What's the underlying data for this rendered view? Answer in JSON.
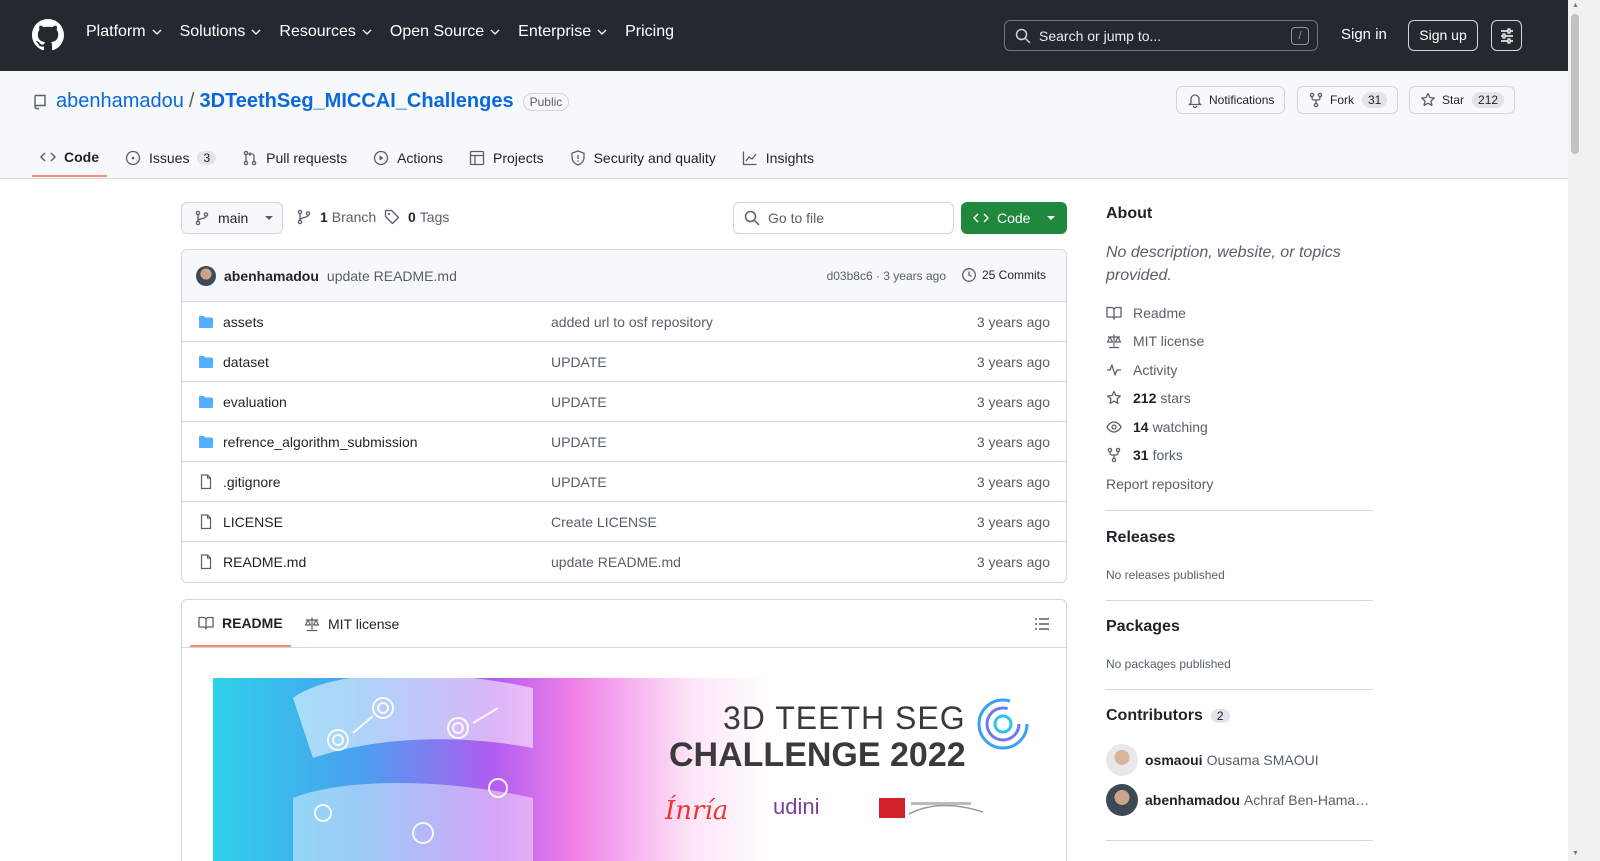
{
  "header": {
    "nav": [
      {
        "label": "Platform"
      },
      {
        "label": "Solutions"
      },
      {
        "label": "Resources"
      },
      {
        "label": "Open Source"
      },
      {
        "label": "Enterprise"
      },
      {
        "label": "Pricing"
      }
    ],
    "search_placeholder": "Search or jump to...",
    "search_shortcut": "/",
    "signin_label": "Sign in",
    "signup_label": "Sign up"
  },
  "repo": {
    "owner": "abenhamadou",
    "separator": "/",
    "name": "3DTeethSeg_MICCAI_Challenges",
    "visibility": "Public",
    "notifications_label": "Notifications",
    "fork_label": "Fork",
    "fork_count": "31",
    "star_label": "Star",
    "star_count": "212"
  },
  "tabs": [
    {
      "label": "Code"
    },
    {
      "label": "Issues",
      "count": "3"
    },
    {
      "label": "Pull requests"
    },
    {
      "label": "Actions"
    },
    {
      "label": "Projects"
    },
    {
      "label": "Security and quality"
    },
    {
      "label": "Insights"
    }
  ],
  "toolbar": {
    "branch": "main",
    "branch_count": "1",
    "branch_word": "Branch",
    "tag_count": "0",
    "tag_word": "Tags",
    "goto_placeholder": "Go to file",
    "code_label": "Code"
  },
  "commit": {
    "author": "abenhamadou",
    "message": "update README.md",
    "meta": "d03b8c6 · 3 years ago",
    "commits_label": "25 Commits"
  },
  "files": [
    {
      "type": "folder",
      "name": "assets",
      "message": "added url to osf repository",
      "age": "3 years ago"
    },
    {
      "type": "folder",
      "name": "dataset",
      "message": "UPDATE",
      "age": "3 years ago"
    },
    {
      "type": "folder",
      "name": "evaluation",
      "message": "UPDATE",
      "age": "3 years ago"
    },
    {
      "type": "folder",
      "name": "refrence_algorithm_submission",
      "message": "UPDATE",
      "age": "3 years ago"
    },
    {
      "type": "file",
      "name": ".gitignore",
      "message": "UPDATE",
      "age": "3 years ago"
    },
    {
      "type": "file",
      "name": "LICENSE",
      "message": "Create LICENSE",
      "age": "3 years ago"
    },
    {
      "type": "file",
      "name": "README.md",
      "message": "update README.md",
      "age": "3 years ago"
    }
  ],
  "readme": {
    "tab_readme": "README",
    "tab_license": "MIT license",
    "banner_line1": "3D TEETH SEG",
    "banner_line2": "CHALLENGE 2022",
    "banner_logo_inria": "Ínría",
    "banner_logo_udini": "udini"
  },
  "sidebar": {
    "about_title": "About",
    "about_desc": "No description, website, or topics provided.",
    "readme_link": "Readme",
    "license_link": "MIT license",
    "activity_link": "Activity",
    "stars_count": "212",
    "stars_word": "stars",
    "watching_count": "14",
    "watching_word": "watching",
    "forks_count": "31",
    "forks_word": "forks",
    "report_link": "Report repository",
    "releases_title": "Releases",
    "releases_text": "No releases published",
    "packages_title": "Packages",
    "packages_text": "No packages published",
    "contributors_title": "Contributors",
    "contributors_count": "2",
    "contributors": [
      {
        "login": "osmaoui",
        "name": "Ousama SMAOUI"
      },
      {
        "login": "abenhamadou",
        "name": "Achraf Ben-Hamadou"
      }
    ]
  },
  "colors": {
    "header_bg": "#24292f",
    "link": "#0969da",
    "primary_button": "#1f883d",
    "active_tab_underline": "#fd8c73"
  }
}
